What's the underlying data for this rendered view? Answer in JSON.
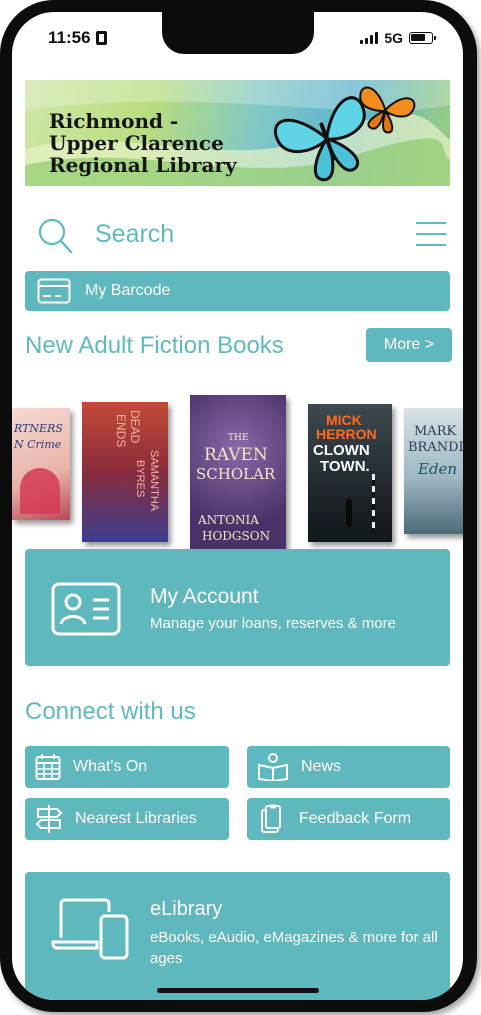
{
  "status_bar": {
    "time": "11:56",
    "network": "5G"
  },
  "banner": {
    "lines": [
      "Richmond -",
      "Upper Clarence",
      "Regional Library"
    ]
  },
  "search": {
    "label": "Search"
  },
  "barcode": {
    "label": "My Barcode"
  },
  "new_books": {
    "title": "New Adult Fiction Books",
    "more_label": "More >",
    "books": [
      {
        "title": "Partners in Crime",
        "cover_text": [
          "RTNERS",
          "N Crime"
        ]
      },
      {
        "title": "Dead Ends",
        "author": "Samantha Byres",
        "cover_text": [
          "DEAD",
          "ENDS",
          "SAMANTHA",
          "BYRES"
        ]
      },
      {
        "title": "The Raven Scholar",
        "author": "Antonia Hodgson",
        "cover_text": [
          "THE",
          "RAVEN",
          "SCHOLAR",
          "ANTONIA",
          "HODGSON"
        ]
      },
      {
        "title": "Clown Town",
        "author": "Mick Herron",
        "cover_text": [
          "MICK",
          "HERRON",
          "CLOWN",
          "TOWN."
        ]
      },
      {
        "title": "Eden",
        "author": "Mark Brandi",
        "cover_text": [
          "MARK",
          "BRANDI",
          "Eden"
        ]
      }
    ]
  },
  "account": {
    "title": "My Account",
    "subtitle": "Manage your loans, reserves & more"
  },
  "connect": {
    "title": "Connect with us",
    "buttons": [
      {
        "label": "What's On",
        "icon": "calendar-icon"
      },
      {
        "label": "News",
        "icon": "open-book-icon"
      },
      {
        "label": "Nearest Libraries",
        "icon": "signpost-icon"
      },
      {
        "label": "Feedback Form",
        "icon": "clipboard-icon"
      }
    ]
  },
  "elibrary": {
    "title": "eLibrary",
    "subtitle": "eBooks, eAudio, eMagazines & more for all ages"
  },
  "colors": {
    "accent": "#5fb8bd",
    "accent_text": "#5fbac0"
  }
}
